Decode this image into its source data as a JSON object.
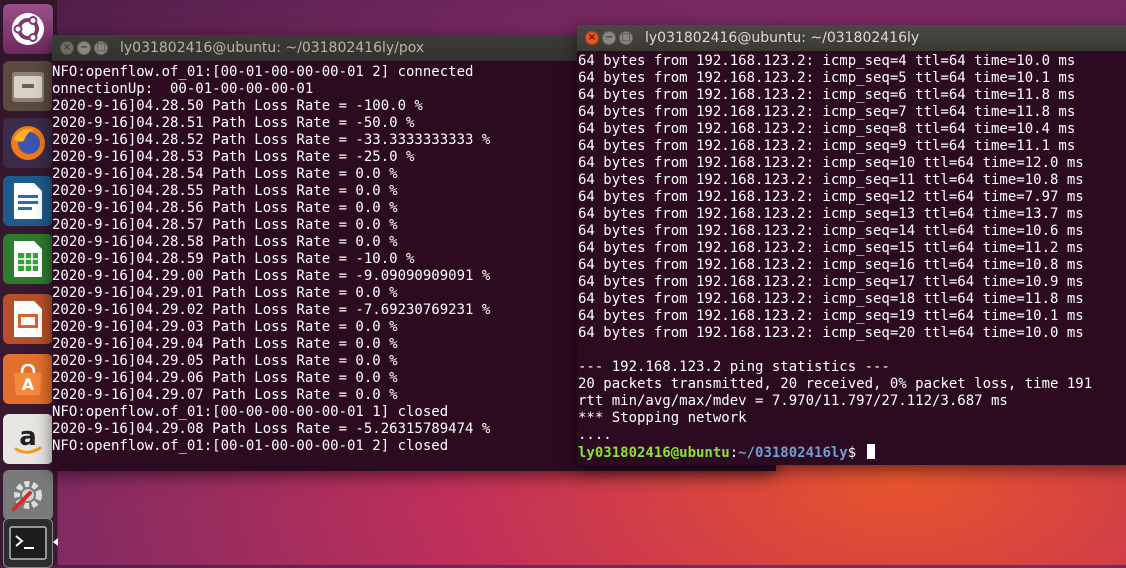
{
  "left_terminal": {
    "title": "ly031802416@ubuntu: ~/031802416ly/pox",
    "lines": [
      "NFO:openflow.of_01:[00-01-00-00-00-01 2] connected",
      "onnectionUp:  00-01-00-00-00-01",
      "2020-9-16]04.28.50 Path Loss Rate = -100.0 %",
      "2020-9-16]04.28.51 Path Loss Rate = -50.0 %",
      "2020-9-16]04.28.52 Path Loss Rate = -33.3333333333 %",
      "2020-9-16]04.28.53 Path Loss Rate = -25.0 %",
      "2020-9-16]04.28.54 Path Loss Rate = 0.0 %",
      "2020-9-16]04.28.55 Path Loss Rate = 0.0 %",
      "2020-9-16]04.28.56 Path Loss Rate = 0.0 %",
      "2020-9-16]04.28.57 Path Loss Rate = 0.0 %",
      "2020-9-16]04.28.58 Path Loss Rate = 0.0 %",
      "2020-9-16]04.28.59 Path Loss Rate = -10.0 %",
      "2020-9-16]04.29.00 Path Loss Rate = -9.09090909091 %",
      "2020-9-16]04.29.01 Path Loss Rate = 0.0 %",
      "2020-9-16]04.29.02 Path Loss Rate = -7.69230769231 %",
      "2020-9-16]04.29.03 Path Loss Rate = 0.0 %",
      "2020-9-16]04.29.04 Path Loss Rate = 0.0 %",
      "2020-9-16]04.29.05 Path Loss Rate = 0.0 %",
      "2020-9-16]04.29.06 Path Loss Rate = 0.0 %",
      "2020-9-16]04.29.07 Path Loss Rate = 0.0 %",
      "NFO:openflow.of_01:[00-00-00-00-00-01 1] closed",
      "2020-9-16]04.29.08 Path Loss Rate = -5.26315789474 %",
      "NFO:openflow.of_01:[00-01-00-00-00-01 2] closed"
    ]
  },
  "right_terminal": {
    "title": "ly031802416@ubuntu: ~/031802416ly",
    "lines": [
      "64 bytes from 192.168.123.2: icmp_seq=4 ttl=64 time=10.0 ms",
      "64 bytes from 192.168.123.2: icmp_seq=5 ttl=64 time=10.1 ms",
      "64 bytes from 192.168.123.2: icmp_seq=6 ttl=64 time=11.8 ms",
      "64 bytes from 192.168.123.2: icmp_seq=7 ttl=64 time=11.8 ms",
      "64 bytes from 192.168.123.2: icmp_seq=8 ttl=64 time=10.4 ms",
      "64 bytes from 192.168.123.2: icmp_seq=9 ttl=64 time=11.1 ms",
      "64 bytes from 192.168.123.2: icmp_seq=10 ttl=64 time=12.0 ms",
      "64 bytes from 192.168.123.2: icmp_seq=11 ttl=64 time=10.8 ms",
      "64 bytes from 192.168.123.2: icmp_seq=12 ttl=64 time=7.97 ms",
      "64 bytes from 192.168.123.2: icmp_seq=13 ttl=64 time=13.7 ms",
      "64 bytes from 192.168.123.2: icmp_seq=14 ttl=64 time=10.6 ms",
      "64 bytes from 192.168.123.2: icmp_seq=15 ttl=64 time=11.2 ms",
      "64 bytes from 192.168.123.2: icmp_seq=16 ttl=64 time=10.8 ms",
      "64 bytes from 192.168.123.2: icmp_seq=17 ttl=64 time=10.9 ms",
      "64 bytes from 192.168.123.2: icmp_seq=18 ttl=64 time=11.8 ms",
      "64 bytes from 192.168.123.2: icmp_seq=19 ttl=64 time=10.1 ms",
      "64 bytes from 192.168.123.2: icmp_seq=20 ttl=64 time=10.0 ms",
      "",
      "--- 192.168.123.2 ping statistics ---",
      "20 packets transmitted, 20 received, 0% packet loss, time 191",
      "rtt min/avg/max/mdev = 7.970/11.797/27.112/3.687 ms",
      "*** Stopping network",
      "...."
    ],
    "prompt_user": "ly031802416@ubuntu",
    "prompt_sep": ":",
    "prompt_path": "~/031802416ly",
    "prompt_symbol": "$ "
  },
  "launcher": {
    "items": [
      "ubuntu-logo-icon",
      "files-icon",
      "firefox-icon",
      "writer-icon",
      "calc-icon",
      "impress-icon",
      "software-center-icon",
      "amazon-icon",
      "system-settings-icon",
      "terminal-icon"
    ]
  },
  "colors": {
    "terminal_bg": "#2c0a22",
    "prompt_user": "#8ae234",
    "prompt_path": "#729fcf",
    "close_active": "#e95420"
  }
}
